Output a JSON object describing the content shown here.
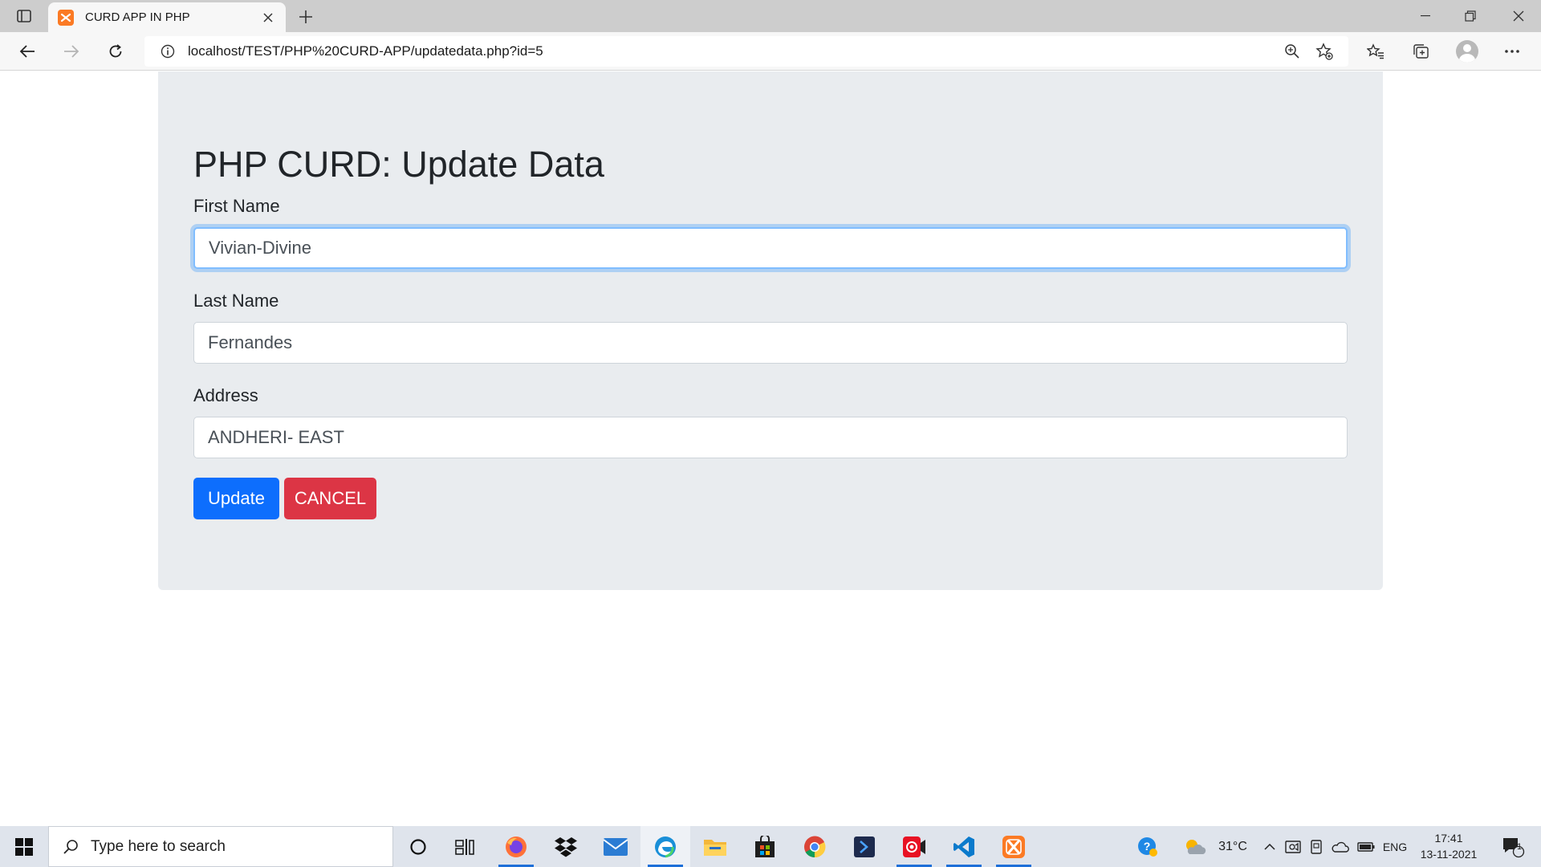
{
  "browser": {
    "tab_title": "CURD APP IN PHP",
    "url": "localhost/TEST/PHP%20CURD-APP/updatedata.php?id=5"
  },
  "page": {
    "title": "PHP CURD: Update Data",
    "fields": [
      {
        "label": "First Name",
        "value": "Vivian-Divine"
      },
      {
        "label": "Last Name",
        "value": "Fernandes"
      },
      {
        "label": "Address",
        "value": "ANDHERI- EAST"
      }
    ],
    "buttons": {
      "update": "Update",
      "cancel": "CANCEL"
    }
  },
  "taskbar": {
    "search_placeholder": "Type here to search",
    "weather": "31°C",
    "language": "ENG",
    "time": "17:41",
    "date": "13-11-2021",
    "notification_count": "1"
  },
  "colors": {
    "primary": "#0d6efd",
    "danger": "#dc3545",
    "jumbotron_bg": "#e9ecef",
    "focus_ring": "#80bdff"
  }
}
